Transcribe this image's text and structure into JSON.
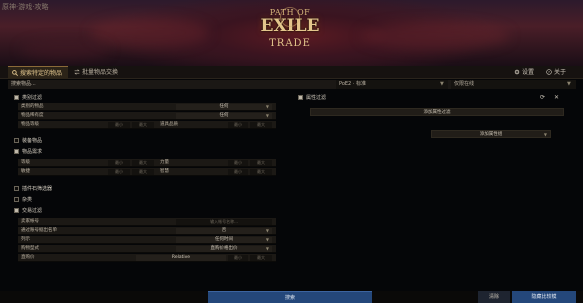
{
  "watermark": "原神·游戏·攻略",
  "logo": {
    "top": "PATH OF",
    "main": "EXILE",
    "bottom": "TRADE"
  },
  "tabs": [
    {
      "label": "搜索特定的物品",
      "icon": "search-icon"
    },
    {
      "label": "批量物品交换",
      "icon": "exchange-icon"
    }
  ],
  "top_right": {
    "settings": "设置",
    "close": "关于"
  },
  "search_row": {
    "search_placeholder": "搜索物品...",
    "league": "PoE2 · 标准",
    "status": "仅限在线"
  },
  "left": {
    "type_filter": "类别过滤",
    "type_rows": [
      {
        "label": "类别的物品",
        "value": "任何"
      },
      {
        "label": "物品稀有度",
        "value": "任何"
      }
    ],
    "level_row": {
      "label": "物品等级",
      "min": "最小",
      "max": "最大",
      "label2": "道具品质",
      "min2": "最小",
      "max2": "最大"
    },
    "weapon_filter": "装备物品",
    "req_filter": "物品需求",
    "req_rows": [
      {
        "label": "等级",
        "min": "最小",
        "max": "最大",
        "label2": "力量",
        "min2": "最小",
        "max2": "最大"
      },
      {
        "label": "敏捷",
        "min": "最小",
        "max": "最大",
        "label2": "智慧",
        "min2": "最小",
        "max2": "最大"
      }
    ],
    "socket_filter": "插件石筛选器",
    "misc_filter": "杂类",
    "trade_filter": "交易过滤",
    "trade_rows": [
      {
        "label": "卖家帐号",
        "placeholder": "输入帐号名称..."
      },
      {
        "label": "通过账号据出名单",
        "value": "否"
      },
      {
        "label": "列示",
        "value": "任何时间"
      },
      {
        "label": "购物型式",
        "value": "直购价格出价"
      }
    ],
    "price_row": {
      "label": "直购价",
      "currency": "Relative",
      "min": "最小",
      "max": "最大"
    }
  },
  "right": {
    "stat_filter": "属性过滤",
    "add_stat": "添加属性过滤",
    "add_stat_group": "添加属性组"
  },
  "footer": {
    "search": "搜索",
    "clear": "清除",
    "bulk": "隐藏比较模"
  }
}
